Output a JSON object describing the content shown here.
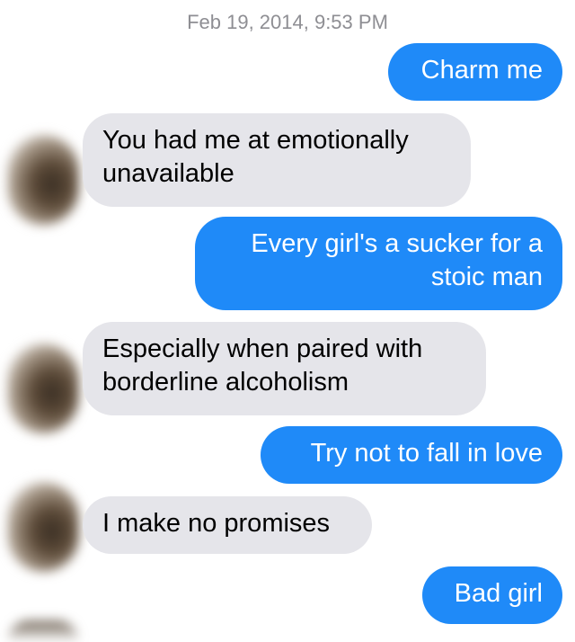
{
  "conversation": {
    "timestamp": "Feb 19, 2014, 9:53 PM",
    "messages": [
      {
        "direction": "outgoing",
        "text": "Charm me"
      },
      {
        "direction": "incoming",
        "line1": "You had me at emotionally",
        "line2": "unavailable"
      },
      {
        "direction": "outgoing",
        "line1": "Every girl's a sucker for a",
        "line2": "stoic man"
      },
      {
        "direction": "incoming",
        "line1": "Especially when paired with",
        "line2": "borderline alcoholism"
      },
      {
        "direction": "outgoing",
        "text": "Try not to fall in love"
      },
      {
        "direction": "incoming",
        "text": "I make no promises"
      },
      {
        "direction": "outgoing",
        "text": "Bad girl"
      }
    ]
  },
  "colors": {
    "outgoing_bubble": "#1f8af8",
    "incoming_bubble": "#e5e5ea",
    "timestamp_text": "#8e8e93"
  }
}
